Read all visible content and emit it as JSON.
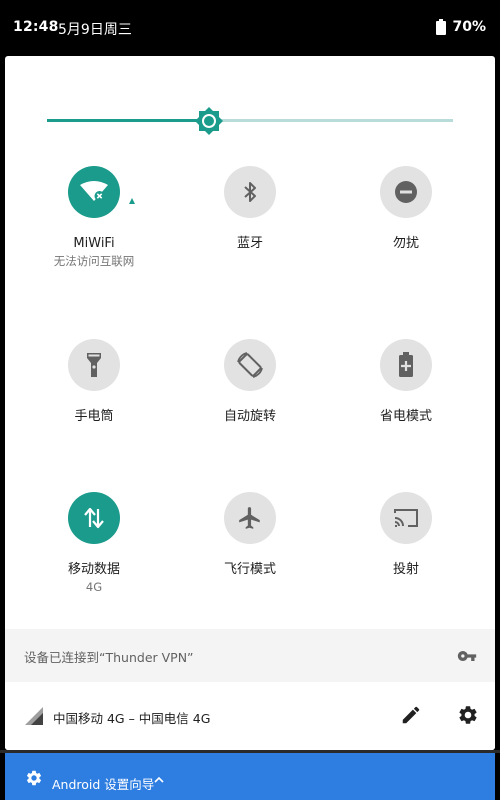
{
  "status_bar": {
    "time": "12:48",
    "date": "5月9日周三",
    "battery": "70%"
  },
  "brightness": {
    "level": 0.4
  },
  "tiles": [
    {
      "id": "wifi",
      "label": "MiWiFi",
      "sub": "无法访问互联网",
      "icon": "wifi-no-internet-icon",
      "active": true
    },
    {
      "id": "bluetooth",
      "label": "蓝牙",
      "sub": "",
      "icon": "bluetooth-icon",
      "active": false
    },
    {
      "id": "dnd",
      "label": "勿扰",
      "sub": "",
      "icon": "do-not-disturb-icon",
      "active": false
    },
    {
      "id": "flashlight",
      "label": "手电筒",
      "sub": "",
      "icon": "flashlight-icon",
      "active": false
    },
    {
      "id": "autorotate",
      "label": "自动旋转",
      "sub": "",
      "icon": "auto-rotate-icon",
      "active": false
    },
    {
      "id": "battery-saver",
      "label": "省电模式",
      "sub": "",
      "icon": "battery-saver-icon",
      "active": false
    },
    {
      "id": "mobile-data",
      "label": "移动数据",
      "sub": "4G",
      "icon": "mobile-data-icon",
      "active": true
    },
    {
      "id": "airplane",
      "label": "飞行模式",
      "sub": "",
      "icon": "airplane-icon",
      "active": false
    },
    {
      "id": "cast",
      "label": "投射",
      "sub": "",
      "icon": "cast-icon",
      "active": false
    }
  ],
  "vpn": {
    "text": "设备已连接到“Thunder VPN”"
  },
  "carrier": {
    "text": "中国移动 4G – 中国电信 4G"
  },
  "notification": {
    "text": "Android 设置向导"
  },
  "colors": {
    "accent": "#1a9b8b",
    "tile_inactive": "#e2e2e2",
    "notification": "#2e7de1"
  }
}
